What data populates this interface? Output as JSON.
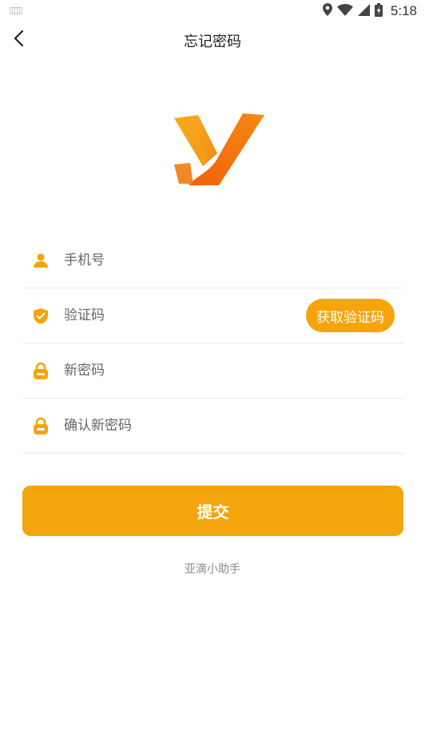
{
  "status_bar": {
    "time": "5:18",
    "icons": [
      "keyboard-icon",
      "location-icon",
      "wifi-icon",
      "signal-icon",
      "battery-icon"
    ]
  },
  "header": {
    "title": "忘记密码",
    "back_icon": "chevron-left-icon"
  },
  "logo": {
    "name": "y-logo",
    "colors": [
      "#f7a21b",
      "#f36b0c"
    ]
  },
  "form": {
    "phone": {
      "placeholder": "手机号",
      "value": "",
      "icon": "person-icon"
    },
    "code": {
      "placeholder": "验证码",
      "value": "",
      "icon": "shield-check-icon",
      "button_label": "获取验证码"
    },
    "new_password": {
      "placeholder": "新密码",
      "value": "",
      "icon": "lock-icon"
    },
    "confirm_password": {
      "placeholder": "确认新密码",
      "value": "",
      "icon": "lock-icon"
    }
  },
  "submit": {
    "label": "提交"
  },
  "footer": {
    "text": "亚滴小助手"
  },
  "colors": {
    "accent": "#f5a50b",
    "divider": "#ececec",
    "title_text": "#222222",
    "placeholder_text": "#666666",
    "footer_text": "#888888"
  }
}
